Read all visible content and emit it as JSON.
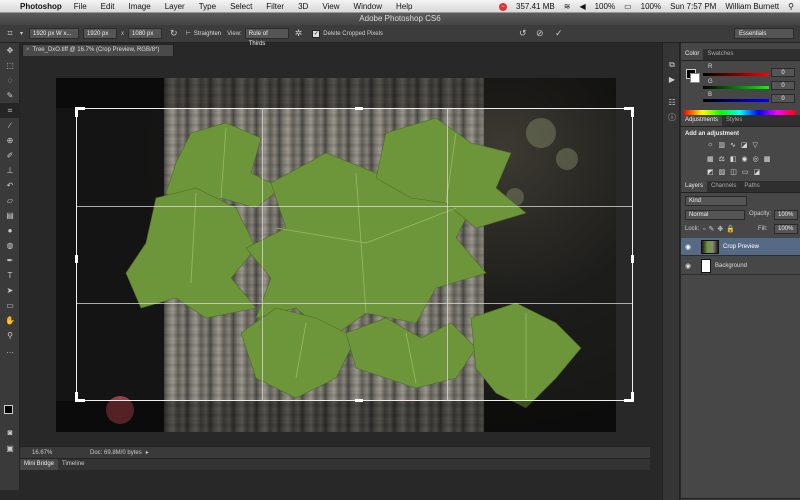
{
  "menubar": {
    "app_name": "Photoshop",
    "menus": [
      "File",
      "Edit",
      "Image",
      "Layer",
      "Type",
      "Select",
      "Filter",
      "3D",
      "View",
      "Window",
      "Help"
    ],
    "memory": "357.41 MB",
    "battery": "100%",
    "volume": "100%",
    "clock": "Sun 7:57 PM",
    "user": "William Burnett"
  },
  "window": {
    "title": "Adobe Photoshop CS6"
  },
  "options_bar": {
    "ratio_select": "1920 px W x...",
    "width_value": "1920 px",
    "x_sep": "x",
    "height_value": "1080 px",
    "straighten_label": "Straighten",
    "view_label": "View:",
    "view_value": "Rule of Thirds",
    "delete_cropped_label": "Delete Cropped Pixels",
    "workspace": "Essentials"
  },
  "document": {
    "tab_title": "Tree_DxO.tiff @ 16.7% (Crop Preview, RGB/8*)"
  },
  "status": {
    "zoom": "16.67%",
    "doc_info": "Doc: 69.8M/0 bytes"
  },
  "bottom_tabs": [
    "Mini Bridge",
    "Timeline"
  ],
  "color_panel": {
    "tabs": [
      "Color",
      "Swatches"
    ],
    "channels": [
      {
        "label": "R",
        "value": "0",
        "color": "#d43434"
      },
      {
        "label": "G",
        "value": "0",
        "color": "#3db33d"
      },
      {
        "label": "B",
        "value": "0",
        "color": "#3a56d4"
      }
    ]
  },
  "adjustments_panel": {
    "tabs": [
      "Adjustments",
      "Styles"
    ],
    "title": "Add an adjustment"
  },
  "layers_panel": {
    "tabs": [
      "Layers",
      "Channels",
      "Paths"
    ],
    "kind_label": "Kind",
    "blend_mode": "Normal",
    "opacity_label": "Opacity:",
    "opacity_value": "100%",
    "lock_label": "Lock:",
    "fill_label": "Fill:",
    "fill_value": "100%",
    "layers": [
      {
        "name": "Crop Preview",
        "selected": true
      },
      {
        "name": "Background",
        "selected": false
      }
    ]
  }
}
